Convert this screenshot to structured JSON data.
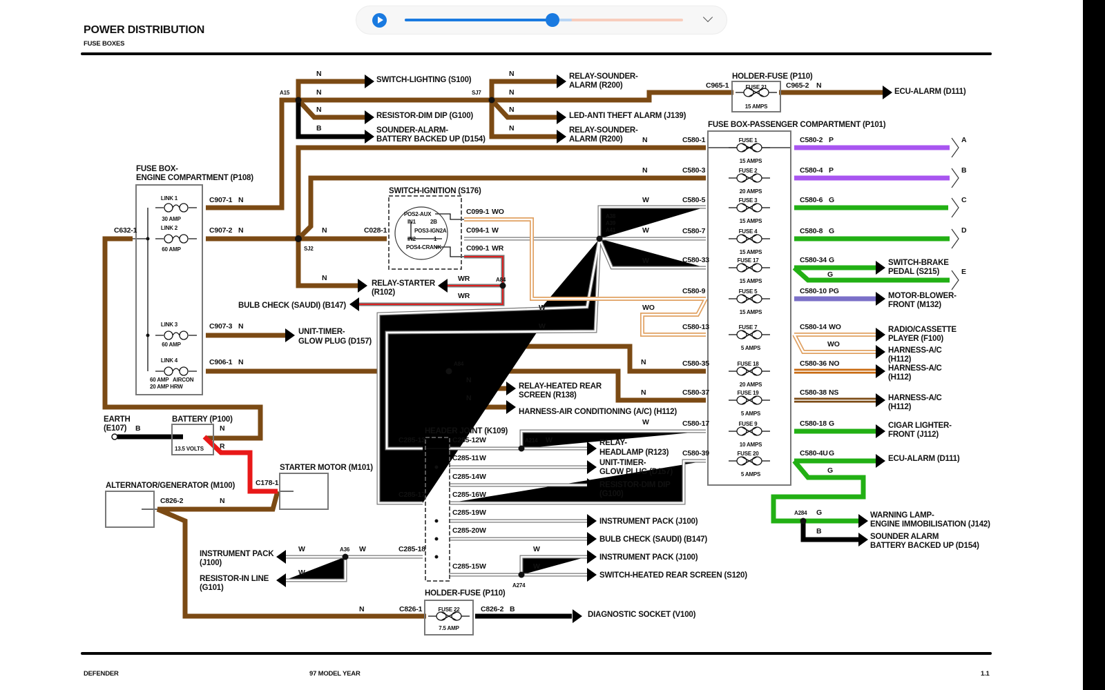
{
  "header": {
    "title": "POWER DISTRIBUTION",
    "subtitle": "FUSE BOXES"
  },
  "footer": {
    "left": "DEFENDER",
    "center": "97 MODEL YEAR",
    "page": "1.1"
  },
  "player": {
    "progress": 0.53,
    "buffered": 0.6,
    "play_icon": "play-icon",
    "menu_icon": "chevron-down-icon",
    "accent": "#1a7ae0"
  },
  "colors": {
    "N": "#7b4a14",
    "B": "#000000",
    "R": "#e81818",
    "P": "#a855f0",
    "G": "#22b014",
    "PG": "#7b70c8",
    "NO": "#c86a10",
    "W": "#ffffff",
    "WO": "#e0a060",
    "WR": "#e02020"
  },
  "wc": {
    "N": "N",
    "B": "B",
    "R": "R",
    "W": "W",
    "WO": "WO",
    "WR": "WR",
    "P": "P",
    "G": "G",
    "PG": "PG",
    "NO": "NO",
    "NS": "NS"
  },
  "comp": {
    "switch_lighting": "SWITCH-LIGHTING (S100)",
    "resistor_dim_dip": "RESISTOR-DIM DIP (G100)",
    "sounder_alarm_1": "SOUNDER-ALARM-",
    "sounder_alarm_2": "BATTERY BACKED UP (D154)",
    "relay_sounder_1": "RELAY-SOUNDER-",
    "relay_sounder_2": "ALARM (R200)",
    "led_anti_theft": "LED-ANTI THEFT ALARM (J139)",
    "holder_fuse": "HOLDER-FUSE (P110)",
    "ecu_alarm": "ECU-ALARM (D111)",
    "fusebox_pass": "FUSE BOX-PASSENGER COMPARTMENT (P101)",
    "fusebox_eng_1": "FUSE BOX-",
    "fusebox_eng_2": "ENGINE COMPARTMENT (P108)",
    "switch_ignition": "SWITCH-IGNITION (S176)",
    "relay_starter_1": "RELAY-STARTER",
    "relay_starter_2": "(R102)",
    "bulb_check": "BULB CHECK (SAUDI) (B147)",
    "unit_timer_1": "UNIT-TIMER-",
    "unit_timer_2": "GLOW PLUG (D157)",
    "relay_heated_1": "RELAY-HEATED REAR",
    "relay_heated_2": "SCREEN (R138)",
    "harness_air": "HARNESS-AIR CONDITIONING (A/C) (H112)",
    "earth_1": "EARTH",
    "earth_2": "(E107)",
    "battery": "BATTERY (P100)",
    "battery_volts": "13.5 VOLTS",
    "starter_motor": "STARTER MOTOR (M101)",
    "alternator": "ALTERNATOR/GENERATOR (M100)",
    "header_joint": "HEADER JOINT (K109)",
    "relay_headlamp_1": "RELAY-",
    "relay_headlamp_2": "HEADLAMP (R123)",
    "resistor_dim_2": "(G100)",
    "resistor_dim_1": "RESISTOR-DIM DIP",
    "instrument_pack": "INSTRUMENT PACK (J100)",
    "switch_heated": "SWITCH-HEATED REAR SCREEN (S120)",
    "instrument_pack_1": "INSTRUMENT PACK",
    "instrument_pack_2": "(J100)",
    "resistor_in_line_1": "RESISTOR-IN LINE",
    "resistor_in_line_2": "(G101)",
    "diagnostic": "DIAGNOSTIC SOCKET (V100)",
    "switch_brake_1": "SWITCH-BRAKE",
    "switch_brake_2": "PEDAL (S215)",
    "motor_blower_1": "MOTOR-BLOWER-",
    "motor_blower_2": "FRONT (M132)",
    "radio_1": "RADIO/CASSETTE",
    "radio_2": "PLAYER (F100)",
    "harness_ac_1": "HARNESS-A/C",
    "harness_ac_2": "(H112)",
    "cigar_1": "CIGAR LIGHTER-",
    "cigar_2": "FRONT (J112)",
    "warning_1": "WARNING LAMP-",
    "warning_2": "ENGINE IMMOBILISATION (J142)",
    "sounder_b_1": "SOUNDER ALARM",
    "sounder_b_2": "BATTERY BACKED UP (D154)"
  },
  "ignition": {
    "pos2": "POS2-AUX",
    "in1": "IN1",
    "p2b": "2B",
    "pos3": "POS3-IGN2A",
    "in2": "IN2",
    "p1": "1",
    "pos4": "POS4-CRANK"
  },
  "conn": {
    "c907_1": "C907-1",
    "c907_2": "C907-2",
    "c907_3": "C907-3",
    "c906_1": "C906-1",
    "c632_1": "C632-1",
    "c028_1": "C028-1",
    "a15": "A15",
    "sj7": "SJ7",
    "sj2": "SJ2",
    "c099_1": "C099-1",
    "c094_1": "C094-1",
    "c090_1": "C090-1",
    "a38": "A38",
    "a39": "A39",
    "a41": "A41",
    "a84": "A84",
    "a214": "A214",
    "a274": "A274",
    "a36": "A36",
    "a284": "A284",
    "c965_1": "C965-1",
    "c965_2": "C965-2",
    "c178_1": "C178-1",
    "c826_1": "C826-1",
    "c826_2": "C826-2",
    "c285_13": "C285-13",
    "c285_17": "C285-17",
    "c285_18": "C285-18",
    "c285_12": "C285-12",
    "c285_11": "C285-11",
    "c285_14": "C285-14",
    "c285_16": "C285-16",
    "c285_19": "C285-19",
    "c285_20": "C285-20",
    "c285_15": "C285-15"
  },
  "fusebox_p101": {
    "in": [
      "C580-1",
      "C580-3",
      "C580-5",
      "C580-7",
      "C580-33",
      "C580-9",
      "C580-13",
      "C580-35",
      "C580-37",
      "C580-17",
      "C580-39"
    ],
    "out": [
      "C580-2",
      "C580-4",
      "C580-6",
      "C580-8",
      "C580-34",
      "C580-10",
      "C580-14",
      "C580-36",
      "C580-38",
      "C580-18",
      "C580-4U"
    ],
    "fuses": [
      "FUSE 1",
      "FUSE 2",
      "FUSE 3",
      "FUSE 4",
      "FUSE 17",
      "FUSE 5",
      "FUSE 7",
      "FUSE 18",
      "FUSE 19",
      "FUSE 9",
      "FUSE 20"
    ],
    "amps": [
      "15 AMPS",
      "20 AMPS",
      "15 AMPS",
      "15 AMPS",
      "15 AMPS",
      "15 AMPS",
      "5 AMPS",
      "20 AMPS",
      "5 AMPS",
      "10 AMPS",
      "5 AMPS"
    ],
    "out_colors": [
      "P",
      "P",
      "G",
      "G",
      "G",
      "PG",
      "WO",
      "NO",
      "NS",
      "G",
      "G"
    ],
    "continuations": [
      "A",
      "B",
      "C",
      "D",
      "E"
    ]
  },
  "fusebox_p108": {
    "links": [
      "LINK 1",
      "LINK 2",
      "LINK 3",
      "LINK 4"
    ],
    "amps": [
      "30 AMP",
      "60 AMP",
      "60 AMP",
      "60 AMP   AIRCON"
    ],
    "amps_extra": "20 AMP HRW"
  },
  "holder_top": {
    "fuse": "FUSE 21",
    "amps": "15 AMPS"
  },
  "holder_bottom": {
    "fuse": "FUSE 22",
    "amps": "7.5 AMP"
  }
}
